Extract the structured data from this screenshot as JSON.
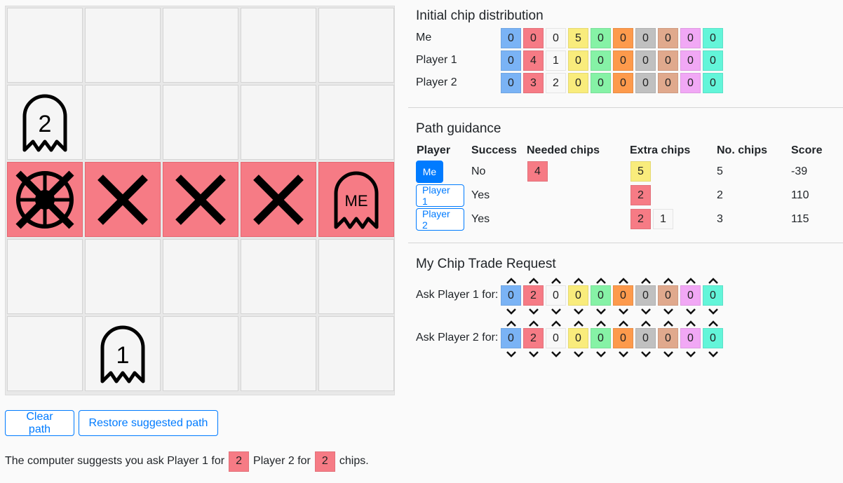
{
  "colors": {
    "blue": "#7ab3f5",
    "red": "#f67b85",
    "white": "#f8f8f8",
    "yellow": "#f9ec7c",
    "green": "#86f2a6",
    "orange": "#fd9a4c",
    "gray": "#c0c0c0",
    "tan": "#e0a98d",
    "pink": "#f1a8f5",
    "teal": "#63f5d9"
  },
  "chip_order": [
    "blue",
    "red",
    "white",
    "yellow",
    "green",
    "orange",
    "gray",
    "tan",
    "pink",
    "teal"
  ],
  "board": {
    "path_cells": [
      [
        2,
        0
      ],
      [
        2,
        1
      ],
      [
        2,
        2
      ],
      [
        2,
        3
      ],
      [
        2,
        4
      ]
    ],
    "tokens": [
      {
        "row": 1,
        "col": 0,
        "type": "ghost",
        "label": "2"
      },
      {
        "row": 4,
        "col": 1,
        "type": "ghost",
        "label": "1"
      },
      {
        "row": 2,
        "col": 4,
        "type": "ghost",
        "label": "ME"
      },
      {
        "row": 2,
        "col": 0,
        "type": "goal-crossed"
      },
      {
        "row": 2,
        "col": 1,
        "type": "x"
      },
      {
        "row": 2,
        "col": 2,
        "type": "x"
      },
      {
        "row": 2,
        "col": 3,
        "type": "x"
      }
    ]
  },
  "buttons": {
    "clear": "Clear path",
    "restore": "Restore suggested path"
  },
  "suggestion": {
    "prefix": "The computer suggests you ask Player 1 for",
    "p1_chip": "2",
    "middle": "Player 2 for",
    "p2_chip": "2",
    "suffix": "chips."
  },
  "initial": {
    "title": "Initial chip distribution",
    "rows": [
      {
        "label": "Me",
        "values": [
          "0",
          "0",
          "0",
          "5",
          "0",
          "0",
          "0",
          "0",
          "0",
          "0"
        ]
      },
      {
        "label": "Player 1",
        "values": [
          "0",
          "4",
          "1",
          "0",
          "0",
          "0",
          "0",
          "0",
          "0",
          "0"
        ]
      },
      {
        "label": "Player 2",
        "values": [
          "0",
          "3",
          "2",
          "0",
          "0",
          "0",
          "0",
          "0",
          "0",
          "0"
        ]
      }
    ]
  },
  "guidance": {
    "title": "Path guidance",
    "headers": [
      "Player",
      "Success",
      "Needed chips",
      "Extra chips",
      "No. chips",
      "Score"
    ],
    "rows": [
      {
        "player": "Me",
        "success": "No",
        "needed": [
          {
            "color": "red",
            "value": "4"
          }
        ],
        "extra": [
          {
            "color": "yellow",
            "value": "5"
          }
        ],
        "count": "5",
        "score": "-39"
      },
      {
        "player": "Player 1",
        "success": "Yes",
        "needed": [],
        "extra": [
          {
            "color": "red",
            "value": "2"
          }
        ],
        "count": "2",
        "score": "110"
      },
      {
        "player": "Player 2",
        "success": "Yes",
        "needed": [],
        "extra": [
          {
            "color": "red",
            "value": "2"
          },
          {
            "color": "white",
            "value": "1"
          }
        ],
        "count": "3",
        "score": "115"
      }
    ]
  },
  "trade": {
    "title": "My Chip Trade Request",
    "rows": [
      {
        "label": "Ask Player 1 for:",
        "values": [
          "0",
          "2",
          "0",
          "0",
          "0",
          "0",
          "0",
          "0",
          "0",
          "0"
        ]
      },
      {
        "label": "Ask Player 2 for:",
        "values": [
          "0",
          "2",
          "0",
          "0",
          "0",
          "0",
          "0",
          "0",
          "0",
          "0"
        ]
      }
    ]
  }
}
